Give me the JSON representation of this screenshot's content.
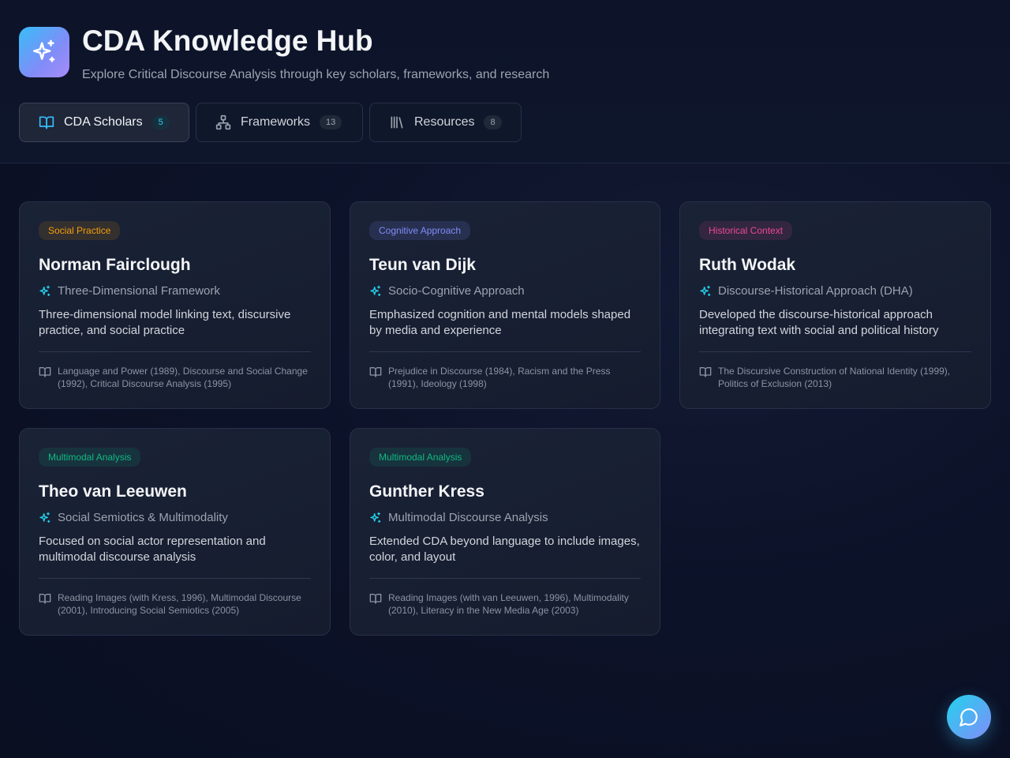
{
  "app": {
    "title": "CDA Knowledge Hub",
    "subtitle": "Explore Critical Discourse Analysis through key scholars, frameworks, and research",
    "logo_icon": "sparkles-icon"
  },
  "tabs": [
    {
      "label": "CDA Scholars",
      "count": "5",
      "icon": "book-open-icon",
      "active": true
    },
    {
      "label": "Frameworks",
      "count": "13",
      "icon": "hierarchy-icon",
      "active": false
    },
    {
      "label": "Resources",
      "count": "8",
      "icon": "library-icon",
      "active": false
    }
  ],
  "colors": {
    "accent": "#22d3ee",
    "social_practice": "#f59e0b",
    "cognitive": "#818cf8",
    "historical": "#ec4899",
    "multimodal": "#10b981"
  },
  "scholars": [
    {
      "tag": "Social Practice",
      "name": "Norman Fairclough",
      "approach": "Three-Dimensional Framework",
      "description": "Three-dimensional model linking text, discursive practice, and social practice",
      "works": "Language and Power (1989), Discourse and Social Change (1992), Critical Discourse Analysis (1995)"
    },
    {
      "tag": "Cognitive Approach",
      "name": "Teun van Dijk",
      "approach": "Socio-Cognitive Approach",
      "description": "Emphasized cognition and mental models shaped by media and experience",
      "works": "Prejudice in Discourse (1984), Racism and the Press (1991), Ideology (1998)"
    },
    {
      "tag": "Historical Context",
      "name": "Ruth Wodak",
      "approach": "Discourse-Historical Approach (DHA)",
      "description": "Developed the discourse-historical approach integrating text with social and political history",
      "works": "The Discursive Construction of National Identity (1999), Politics of Exclusion (2013)"
    },
    {
      "tag": "Multimodal Analysis",
      "name": "Theo van Leeuwen",
      "approach": "Social Semiotics & Multimodality",
      "description": "Focused on social actor representation and multimodal discourse analysis",
      "works": "Reading Images (with Kress, 1996), Multimodal Discourse (2001), Introducing Social Semiotics (2005)"
    },
    {
      "tag": "Multimodal Analysis",
      "name": "Gunther Kress",
      "approach": "Multimodal Discourse Analysis",
      "description": "Extended CDA beyond language to include images, color, and layout",
      "works": "Reading Images (with van Leeuwen, 1996), Multimodality (2010), Literacy in the New Media Age (2003)"
    }
  ],
  "chat": {
    "icon": "chat-bubble-icon"
  }
}
